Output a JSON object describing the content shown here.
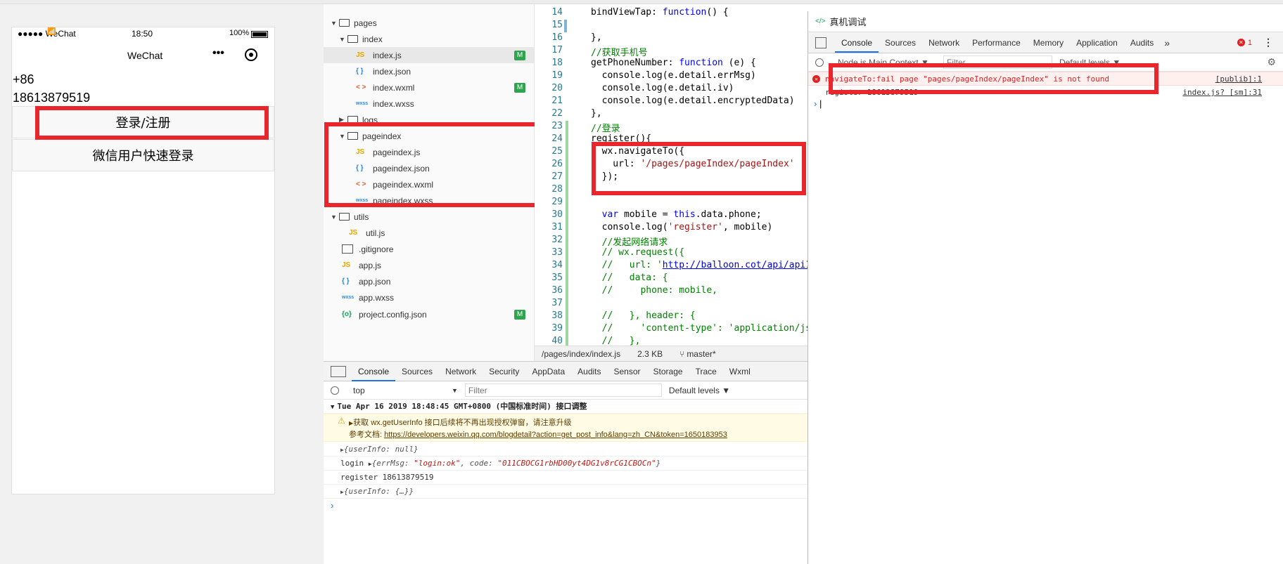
{
  "phone": {
    "carrier": "●●●●● WeChat",
    "time": "18:50",
    "battery": "100%",
    "nav_title": "WeChat",
    "nav_more": "•••",
    "country_code": "+86",
    "phone_number": "18613879519",
    "login_button": "登录/注册",
    "wx_quick_login_button": "微信用户快速登录"
  },
  "tree": {
    "items": [
      {
        "label": "pages"
      },
      {
        "label": "index"
      },
      {
        "label": "index.js",
        "badge": "M"
      },
      {
        "label": "index.json"
      },
      {
        "label": "index.wxml",
        "badge": "M"
      },
      {
        "label": "index.wxss"
      },
      {
        "label": "logs"
      },
      {
        "label": "pageindex"
      },
      {
        "label": "pageindex.js"
      },
      {
        "label": "pageindex.json"
      },
      {
        "label": "pageindex.wxml"
      },
      {
        "label": "pageindex.wxss"
      },
      {
        "label": "utils"
      },
      {
        "label": "util.js"
      },
      {
        "label": ".gitignore"
      },
      {
        "label": "app.js"
      },
      {
        "label": "app.json"
      },
      {
        "label": "app.wxss"
      },
      {
        "label": "project.config.json",
        "badge": "M"
      }
    ],
    "icons": {
      "js": "JS",
      "json": "{ }",
      "wxml": "< >",
      "wxss": "wxss",
      "config": "{o}"
    }
  },
  "editor": {
    "line_numbers": [
      "14",
      "15",
      "16",
      "17",
      "18",
      "19",
      "20",
      "21",
      "22",
      "23",
      "24",
      "25",
      "26",
      "27",
      "28",
      "29",
      "30",
      "31",
      "32",
      "33",
      "34",
      "35",
      "36",
      "37",
      "38",
      "39",
      "40"
    ],
    "lines": {
      "l14a": "bindViewTap: ",
      "l14b": "function",
      "l14c": "() {",
      "l16": "},",
      "l17": "//获取手机号",
      "l18a": "getPhoneNumber: ",
      "l18b": "function",
      "l18c": " (e) {",
      "l19": "  console.log(e.detail.errMsg)",
      "l20": "  console.log(e.detail.iv)",
      "l21": "  console.log(e.detail.encryptedData)",
      "l22": "},",
      "l23": "//登录",
      "l24": "register(){",
      "l25": "  wx.navigateTo({",
      "l26a": "    url: ",
      "l26b": "'/pages/pageIndex/pageIndex'",
      "l27": "  });",
      "l30a": "  ",
      "l30b": "var",
      "l30c": " mobile = ",
      "l30d": "this",
      "l30e": ".data.phone;",
      "l31a": "  console.log(",
      "l31b": "'register'",
      "l31c": ", mobile)",
      "l32": "  //发起网络请求",
      "l33": "  // wx.request({",
      "l34a": "  //   url: '",
      "l34b": "http://balloon.cot/api/api1",
      "l35": "  //   data: {",
      "l36": "  //     phone: mobile,",
      "l38": "  //   }, header: {",
      "l39": "  //     'content-type': 'application/jso",
      "l40": "  //   },"
    },
    "status": {
      "path": "/pages/index/index.js",
      "size": "2.3 KB",
      "branch": "master*"
    }
  },
  "console": {
    "tabs": [
      "Console",
      "Sources",
      "Network",
      "Security",
      "AppData",
      "Audits",
      "Sensor",
      "Storage",
      "Trace",
      "Wxml"
    ],
    "context": "top",
    "filter_placeholder": "Filter",
    "levels": "Default levels ▼",
    "group_header": "Tue Apr 16 2019 18:48:45 GMT+0800 (中国标准时间) 接口调整",
    "warn_line1": "获取 wx.getUserInfo 接口后续将不再出现授权弹窗，请注意升级",
    "warn_line2_label": "参考文档: ",
    "warn_line2_link": "https://developers.weixin.qq.com/blogdetail?action=get_post_info&lang=zh_CN&token=1650183953",
    "userinfo_null": "{userInfo: null}",
    "login_label": "login ",
    "login_obj_a": "{errMsg: ",
    "login_obj_b": "\"login:ok\"",
    "login_obj_c": ", code: ",
    "login_obj_d": "\"011CBOCG1rbHD00yt4DG1v8rCG1CBOCn\"",
    "login_obj_e": "}",
    "register_line": "register 18613879519",
    "userinfo_obj": "{userInfo: {…}}"
  },
  "remote": {
    "title": "真机调试",
    "tabs": [
      "Console",
      "Sources",
      "Network",
      "Performance",
      "Memory",
      "Application",
      "Audits"
    ],
    "more": "»",
    "error_count": "1",
    "context": "Node.js Main Context ▼",
    "filter_placeholder": "Filter",
    "levels": "Default levels ▼",
    "error_text": "navigateTo:fail page \"pages/pageIndex/pageIndex\" is not found",
    "error_source": "[publib]:1",
    "log_source": "index.js? [sm]:31",
    "log_text": "register 18613879519"
  },
  "colors": {
    "highlight_red": "#e8262b",
    "active_tab": "#1a73e8",
    "error_red": "#e02020"
  }
}
